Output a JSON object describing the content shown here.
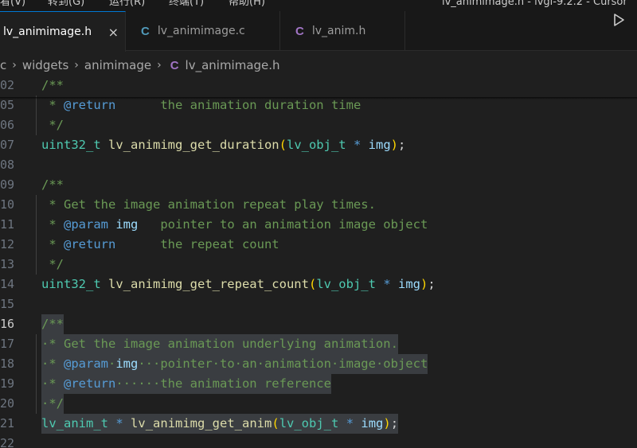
{
  "menubar": {
    "items": [
      "看(V)",
      "转到(G)",
      "运行(R)",
      "终端(T)",
      "帮助(H)"
    ],
    "window_title": "lv_animimage.h - lvgl-9.2.2 - Cursor"
  },
  "tabs": [
    {
      "label": "lv_animimage.h",
      "icon": "",
      "active": true,
      "close": "×"
    },
    {
      "label": "lv_animimage.c",
      "icon": "C",
      "icon_color": "#519aba",
      "active": false
    },
    {
      "label": "lv_anim.h",
      "icon": "C",
      "icon_color": "#a074c4",
      "active": false
    }
  ],
  "breadcrumb": {
    "segments": [
      "c",
      "widgets",
      "animimage"
    ],
    "file_icon": "C",
    "file": "lv_animimage.h"
  },
  "editor": {
    "lines": [
      {
        "num": "02",
        "tokens": [
          [
            "cm",
            "/**"
          ]
        ]
      },
      {
        "num": "05",
        "tokens": [
          [
            "cm",
            " * "
          ],
          [
            "kw",
            "@return"
          ],
          [
            "cm",
            "      the animation duration time"
          ]
        ]
      },
      {
        "num": "06",
        "tokens": [
          [
            "cm",
            " */"
          ]
        ]
      },
      {
        "num": "07",
        "tokens": [
          [
            "ty",
            "uint32_t"
          ],
          [
            "pn",
            " "
          ],
          [
            "fn",
            "lv_animimg_get_duration"
          ],
          [
            "br",
            "("
          ],
          [
            "ty",
            "lv_obj_t"
          ],
          [
            "pn",
            " "
          ],
          [
            "kw",
            "*"
          ],
          [
            "pn",
            " "
          ],
          [
            "vr",
            "img"
          ],
          [
            "br",
            ")"
          ],
          [
            "pn",
            ";"
          ]
        ]
      },
      {
        "num": "08",
        "tokens": []
      },
      {
        "num": "09",
        "tokens": [
          [
            "cm",
            "/**"
          ]
        ]
      },
      {
        "num": "10",
        "tokens": [
          [
            "cm",
            " * Get the image animation repeat play times."
          ]
        ]
      },
      {
        "num": "11",
        "tokens": [
          [
            "cm",
            " * "
          ],
          [
            "kw",
            "@param"
          ],
          [
            "cm",
            " "
          ],
          [
            "vr",
            "img"
          ],
          [
            "cm",
            "   pointer to an animation image object"
          ]
        ]
      },
      {
        "num": "12",
        "tokens": [
          [
            "cm",
            " * "
          ],
          [
            "kw",
            "@return"
          ],
          [
            "cm",
            "      the repeat count"
          ]
        ]
      },
      {
        "num": "13",
        "tokens": [
          [
            "cm",
            " */"
          ]
        ]
      },
      {
        "num": "14",
        "tokens": [
          [
            "ty",
            "uint32_t"
          ],
          [
            "pn",
            " "
          ],
          [
            "fn",
            "lv_animimg_get_repeat_count"
          ],
          [
            "br",
            "("
          ],
          [
            "ty",
            "lv_obj_t"
          ],
          [
            "pn",
            " "
          ],
          [
            "kw",
            "*"
          ],
          [
            "pn",
            " "
          ],
          [
            "vr",
            "img"
          ],
          [
            "br",
            ")"
          ],
          [
            "pn",
            ";"
          ]
        ]
      },
      {
        "num": "15",
        "tokens": []
      },
      {
        "num": "16",
        "current": true,
        "sel": true,
        "tokens": [
          [
            "cm",
            "/**"
          ]
        ]
      },
      {
        "num": "17",
        "sel": true,
        "tokens": [
          [
            "cm",
            "·* Get the image animation underlying animation."
          ]
        ]
      },
      {
        "num": "18",
        "sel": true,
        "tokens": [
          [
            "cm",
            "·* "
          ],
          [
            "kw",
            "@param"
          ],
          [
            "cm",
            "·"
          ],
          [
            "vr",
            "img"
          ],
          [
            "cm",
            "···pointer·to·an·animation·image·object"
          ]
        ]
      },
      {
        "num": "19",
        "sel": true,
        "tokens": [
          [
            "cm",
            "·* "
          ],
          [
            "kw",
            "@return"
          ],
          [
            "cm",
            "······the animation reference"
          ]
        ]
      },
      {
        "num": "20",
        "sel": true,
        "tokens": [
          [
            "cm",
            "·*/"
          ]
        ]
      },
      {
        "num": "21",
        "sel": true,
        "tokens": [
          [
            "ty",
            "lv_anim_t"
          ],
          [
            "pn",
            " "
          ],
          [
            "kw",
            "*"
          ],
          [
            "pn",
            " "
          ],
          [
            "fn",
            "lv_animimg_get_anim"
          ],
          [
            "br",
            "("
          ],
          [
            "ty",
            "lv_obj_t"
          ],
          [
            "pn",
            " "
          ],
          [
            "kw",
            "*"
          ],
          [
            "pn",
            " "
          ],
          [
            "vr",
            "img"
          ],
          [
            "br",
            ")"
          ],
          [
            "pn",
            ";"
          ]
        ]
      },
      {
        "num": "22",
        "tokens": []
      }
    ]
  },
  "icons": {
    "run": "play-icon",
    "file_c": "c-file-icon",
    "chevron": "chevron-right-icon"
  },
  "colors": {
    "accent": "#0078d4",
    "comment": "#6a9955",
    "keyword": "#569cd6",
    "type": "#4ec9b0",
    "function": "#dcdcaa"
  }
}
